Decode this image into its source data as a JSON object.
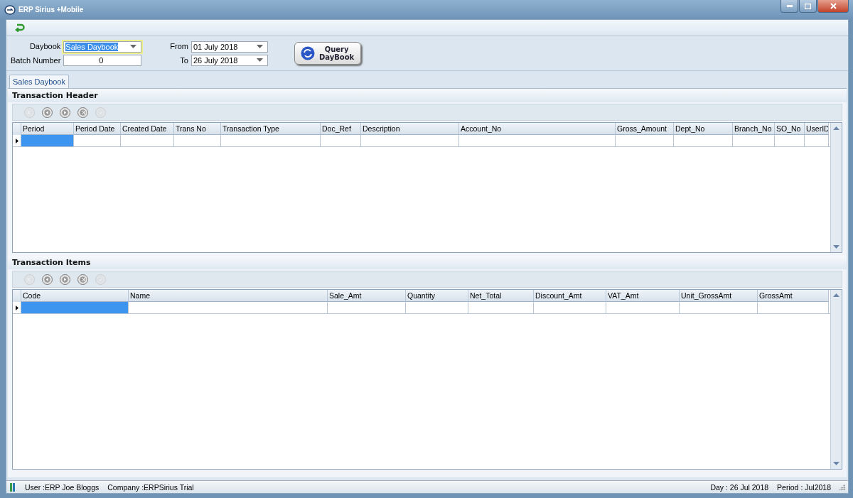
{
  "window": {
    "title": "ERP Sirius +Mobile"
  },
  "filters": {
    "daybook": {
      "label": "Daybook",
      "value": "Sales Daybook",
      "focused": true
    },
    "batch": {
      "label": "Batch Number",
      "value": "0"
    },
    "from": {
      "label": "From",
      "value": "01 July 2018"
    },
    "to": {
      "label": "To",
      "value": "26 July 2018"
    },
    "query_button": "Query\nDayBook"
  },
  "tabs": [
    {
      "label": "Sales Daybook",
      "selected": true
    }
  ],
  "sections": [
    {
      "title": "Transaction Header",
      "nav_buttons": [
        {
          "disabled": true
        },
        {
          "disabled": false
        },
        {
          "disabled": false
        },
        {
          "disabled": false
        },
        {
          "disabled": true
        }
      ],
      "columns": [
        {
          "label": "Period",
          "selected": true
        },
        {
          "label": "Period Date",
          "selected": false
        },
        {
          "label": "Created Date",
          "selected": false
        },
        {
          "label": "Trans No",
          "selected": false
        },
        {
          "label": "Transaction Type",
          "selected": false
        },
        {
          "label": "Doc_Ref",
          "selected": false
        },
        {
          "label": "Description",
          "selected": false
        },
        {
          "label": "Account_No",
          "selected": false
        },
        {
          "label": "Gross_Amount",
          "selected": false
        },
        {
          "label": "Dept_No",
          "selected": false
        },
        {
          "label": "Branch_No",
          "selected": false
        },
        {
          "label": "SO_No",
          "selected": false
        },
        {
          "label": "UserID",
          "selected": false
        }
      ]
    },
    {
      "title": "Transaction Items",
      "nav_buttons": [
        {
          "disabled": true
        },
        {
          "disabled": false
        },
        {
          "disabled": false
        },
        {
          "disabled": false
        },
        {
          "disabled": true
        }
      ],
      "columns": [
        {
          "label": "Code",
          "selected": true
        },
        {
          "label": "Name",
          "selected": false
        },
        {
          "label": "Sale_Amt",
          "selected": false
        },
        {
          "label": "Quantity",
          "selected": false
        },
        {
          "label": "Net_Total",
          "selected": false
        },
        {
          "label": "Discount_Amt",
          "selected": false
        },
        {
          "label": "VAT_Amt",
          "selected": false
        },
        {
          "label": "Unit_GrossAmt",
          "selected": false
        },
        {
          "label": "GrossAmt",
          "selected": false
        }
      ]
    }
  ],
  "status_bar": {
    "user": "User :ERP Joe Bloggs",
    "company": "Company :ERPSirius Trial",
    "day": "Day : 26 Jul 2018",
    "period": "Period : Jul2018"
  }
}
